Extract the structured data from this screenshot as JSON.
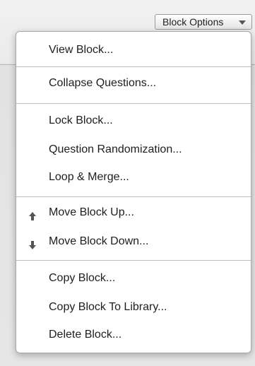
{
  "toolbar": {
    "block_options_label": "Block Options"
  },
  "menu": {
    "items": [
      {
        "label": "View Block..."
      },
      {
        "label": "Collapse Questions..."
      },
      {
        "label": "Lock Block..."
      },
      {
        "label": "Question Randomization..."
      },
      {
        "label": "Loop & Merge..."
      },
      {
        "label": "Move Block Up...",
        "icon": "arrow-up-icon"
      },
      {
        "label": "Move Block Down...",
        "icon": "arrow-down-icon"
      },
      {
        "label": "Copy Block..."
      },
      {
        "label": "Copy Block To Library..."
      },
      {
        "label": "Delete Block..."
      }
    ]
  },
  "colors": {
    "icon": "#555555",
    "divider": "#bdbdbd",
    "menu_border": "#a9a9a9"
  }
}
